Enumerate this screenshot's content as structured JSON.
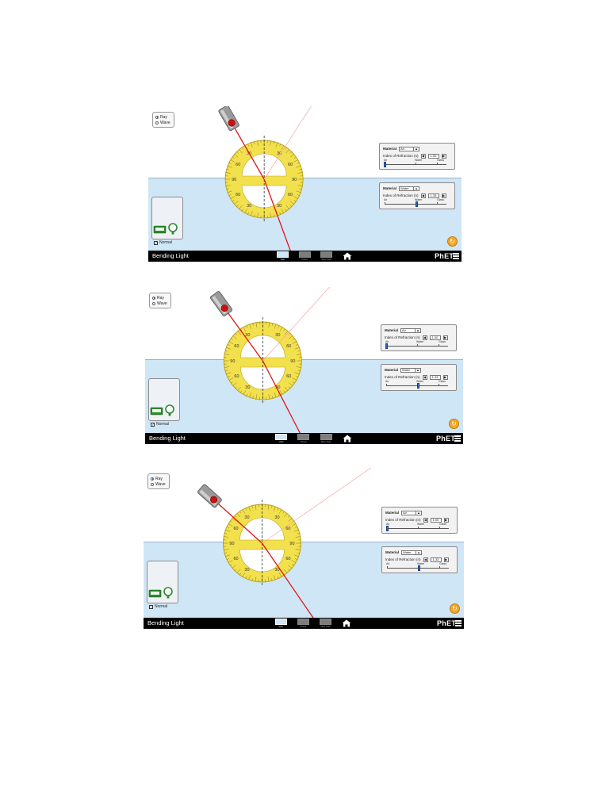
{
  "app": {
    "title": "Bending Light",
    "screens": [
      "Intro",
      "Prisms",
      "More Tools"
    ],
    "logo": "PhET"
  },
  "mode_options": [
    {
      "label": "Ray",
      "selected": true
    },
    {
      "label": "Wave",
      "selected": false
    }
  ],
  "top_medium": {
    "material_label": "Material",
    "material_value": "Air",
    "index_label": "Index of Refraction (n)",
    "index_value": "1.00",
    "slider_labels": [
      "Air",
      "Water",
      "Glass"
    ],
    "slider_fraction": 0.0
  },
  "bottom_medium": {
    "material_label": "Material",
    "material_value": "Water",
    "index_label": "Index of Refraction (n)",
    "index_value": "1.33",
    "slider_labels": [
      "Air",
      "Water",
      "Glass"
    ],
    "slider_fraction": 0.5
  },
  "normal_checkbox": {
    "label": "Normal",
    "checked": true
  },
  "protractor_labels": [
    "30",
    "60",
    "90"
  ],
  "colors": {
    "water": "#cfe6f6",
    "laser_ray": "#e01616",
    "protractor": "#f2e04c",
    "reset": "#f3a728"
  },
  "icons": [
    "laser-pointer-icon",
    "intensity-meter-icon",
    "home-icon",
    "menu-icon",
    "reset-icon",
    "checkbox-icon",
    "radio-icon"
  ]
}
